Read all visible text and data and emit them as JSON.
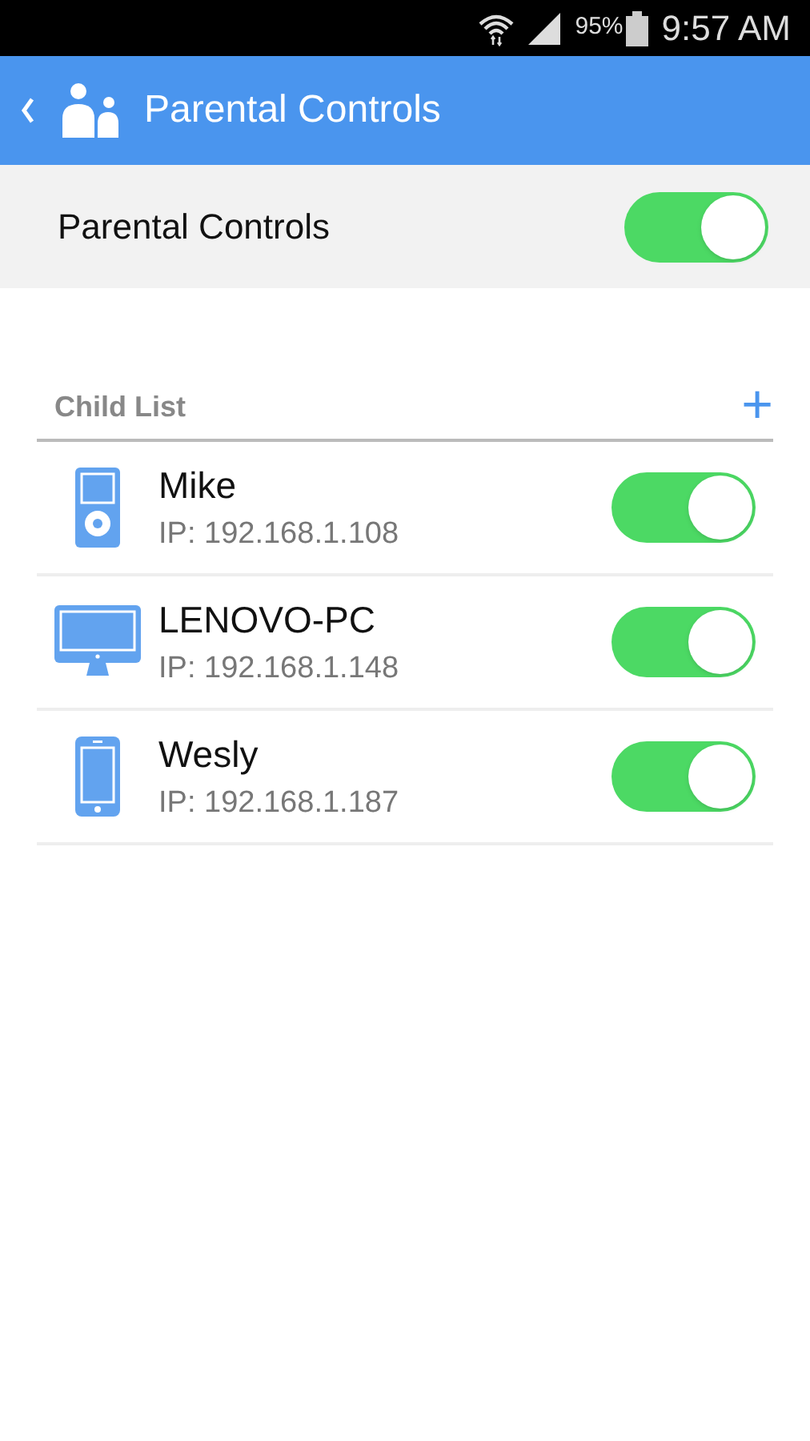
{
  "status_bar": {
    "battery": "95%",
    "time": "9:57 AM"
  },
  "header": {
    "title": "Parental Controls"
  },
  "master_toggle": {
    "label": "Parental Controls",
    "on": true
  },
  "child_list": {
    "title": "Child List",
    "add": "+"
  },
  "children": [
    {
      "kind": "player",
      "name": "Mike",
      "ip": "IP: 192.168.1.108",
      "on": true
    },
    {
      "kind": "monitor",
      "name": "LENOVO-PC",
      "ip": "IP: 192.168.1.148",
      "on": true
    },
    {
      "kind": "phone",
      "name": "Wesly",
      "ip": "IP: 192.168.1.187",
      "on": true
    }
  ]
}
